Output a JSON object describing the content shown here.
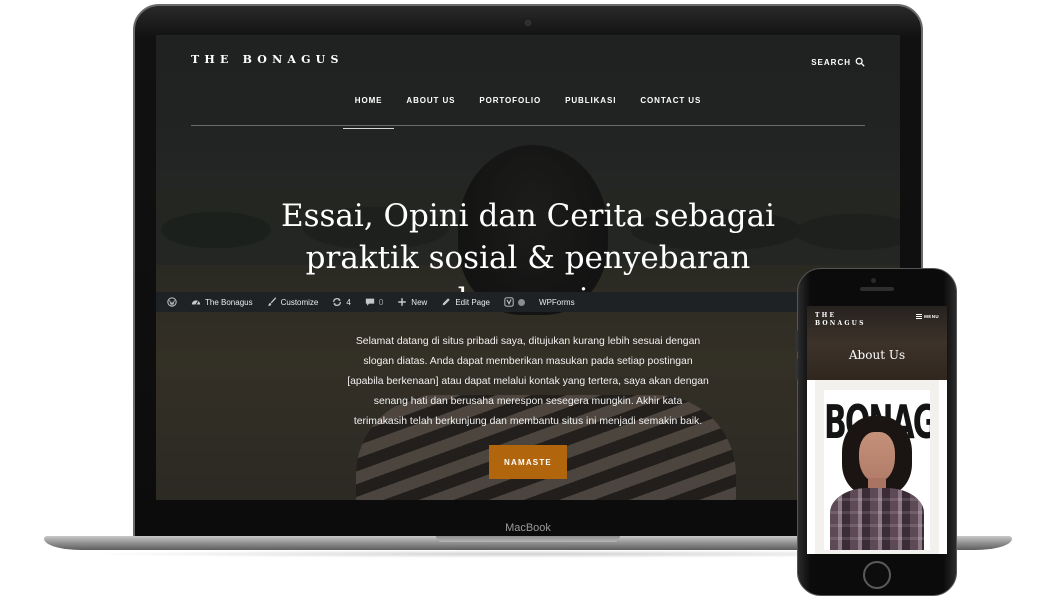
{
  "desktop": {
    "site_title": "THE BONAGUS",
    "search_label": "SEARCH",
    "nav": [
      {
        "label": "HOME",
        "active": true
      },
      {
        "label": "ABOUT US",
        "active": false
      },
      {
        "label": "PORTOFOLIO",
        "active": false
      },
      {
        "label": "PUBLIKASI",
        "active": false
      },
      {
        "label": "CONTACT US",
        "active": false
      }
    ],
    "hero_title": "Essai, Opini dan Cerita sebagai praktik sosial & penyebaran harmoni.",
    "hero_text": "Selamat datang di situs pribadi saya, ditujukan kurang lebih sesuai dengan slogan diatas. Anda dapat memberikan masukan pada setiap postingan [apabila berkenaan] atau dapat melalui kontak yang tertera, saya akan dengan senang hati dan berusaha merespon sesegera mungkin. Akhir kata terimakasih telah berkunjung dan membantu situs ini menjadi semakin baik.",
    "cta_label": "NAMASTE",
    "accent_color": "#b1650c"
  },
  "admin_bar": {
    "wp_logo_icon": "wordpress-icon",
    "site_name": "The Bonagus",
    "customize": "Customize",
    "updates_count": "4",
    "comments_count": "0",
    "new": "New",
    "edit_page": "Edit Page",
    "yoast_icon": "yoast-icon",
    "wpforms": "WPForms"
  },
  "laptop_brand": "MacBook",
  "mobile": {
    "site_title": "THE BONAGUS",
    "menu_label": "MENU",
    "page_heading": "About Us",
    "poster_text": "BONAGUS"
  }
}
